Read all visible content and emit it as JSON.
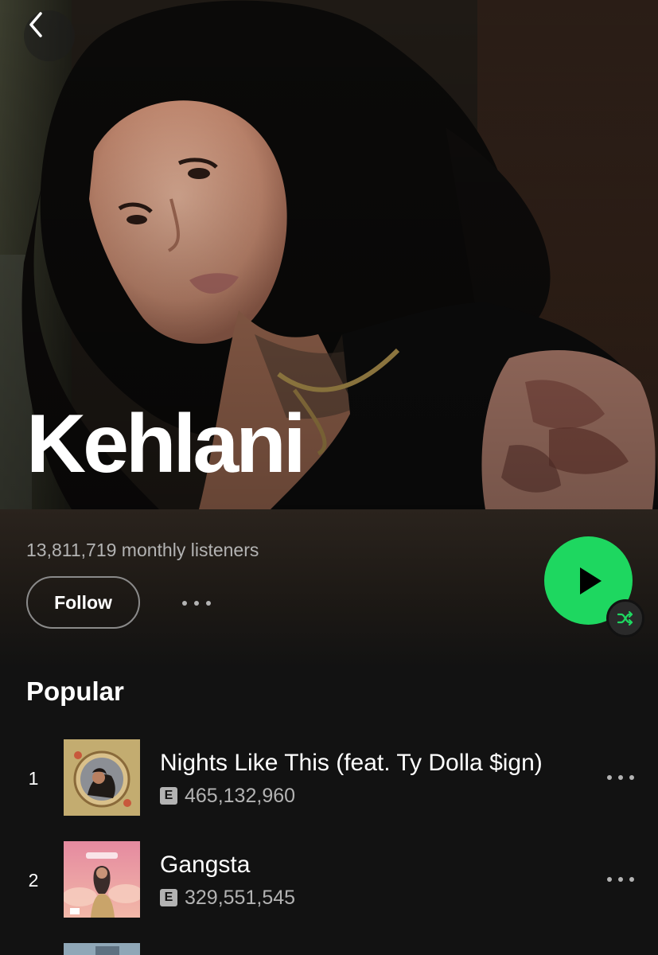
{
  "artist": {
    "name": "Kehlani",
    "monthly_listeners": "13,811,719 monthly listeners"
  },
  "actions": {
    "follow_label": "Follow"
  },
  "icons": {
    "back": "chevron-left-icon",
    "more": "more-horizontal-icon",
    "play": "play-icon",
    "shuffle": "shuffle-icon"
  },
  "colors": {
    "accent": "#1ed760",
    "background": "#121212",
    "text_secondary": "#b3b3b3"
  },
  "popular": {
    "heading": "Popular",
    "tracks": [
      {
        "number": "1",
        "title": "Nights Like This (feat. Ty Dolla $ign)",
        "explicit": "E",
        "plays": "465,132,960"
      },
      {
        "number": "2",
        "title": "Gangsta",
        "explicit": "E",
        "plays": "329,551,545"
      }
    ]
  }
}
